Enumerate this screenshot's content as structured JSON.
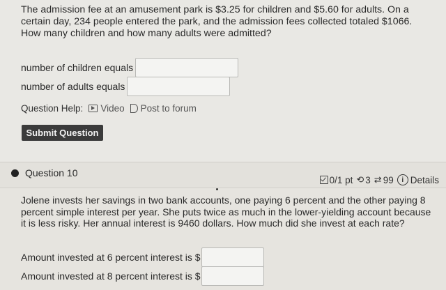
{
  "question9": {
    "text": "The admission fee at an amusement park is $3.25 for children and $5.60 for adults. On a certain day, 234 people entered the park, and the admission fees collected totaled $1066. How many children and how many adults were admitted?",
    "fields": [
      {
        "label": "number of children equals",
        "value": ""
      },
      {
        "label": "number of adults equals",
        "value": ""
      }
    ],
    "help_label": "Question Help:",
    "video_label": "Video",
    "forum_label": "Post to forum",
    "submit_label": "Submit Question"
  },
  "question10": {
    "title": "Question 10",
    "score": "0/1 pt",
    "attempts": "3",
    "retries": "99",
    "details_label": "Details",
    "text": "Jolene invests her savings in two bank accounts, one paying 6 percent and the other paying 8 percent simple interest per year. She puts twice as much in the lower-yielding account because it is less risky. Her annual interest is 9460 dollars. How much did she invest at each rate?",
    "fields": [
      {
        "label": "Amount invested at 6 percent interest is $",
        "value": ""
      },
      {
        "label": "Amount invested at 8 percent interest is $",
        "value": ""
      }
    ]
  },
  "icons": {
    "video": "video-icon",
    "forum": "forum-icon",
    "score": "checkbox-icon",
    "attempts": "retry-icon",
    "retries": "refresh-icon",
    "details": "info-icon"
  },
  "colors": {
    "submit_button": "#3b3b3b",
    "background": "#e6e4df"
  }
}
